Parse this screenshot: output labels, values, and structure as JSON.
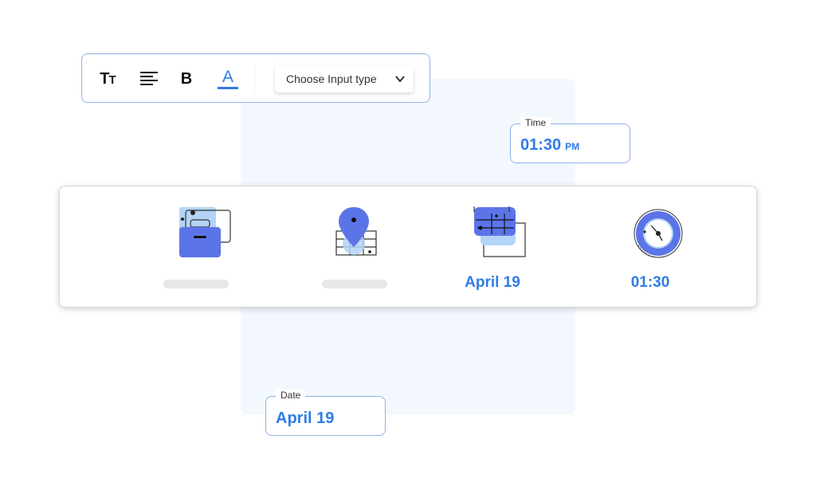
{
  "toolbar": {
    "text_size_label": "T",
    "text_size_small": "T",
    "bold_label": "B",
    "color_label": "A",
    "select": {
      "value": "Choose Input type"
    }
  },
  "time_field": {
    "label": "Time",
    "value": "01:30",
    "suffix": "PM"
  },
  "date_field": {
    "label": "Date",
    "value": "April 19"
  },
  "card": {
    "items": [
      {
        "icon": "briefcase-icon",
        "label": ""
      },
      {
        "icon": "location-pin-icon",
        "label": ""
      },
      {
        "icon": "calendar-icon",
        "label": "April 19"
      },
      {
        "icon": "clock-icon",
        "label": "01:30"
      }
    ]
  },
  "colors": {
    "accent": "#2f7be6",
    "icon_fill": "#5b74e8",
    "icon_light": "#b3d4f7",
    "panel_bg": "#f3f8fe"
  }
}
